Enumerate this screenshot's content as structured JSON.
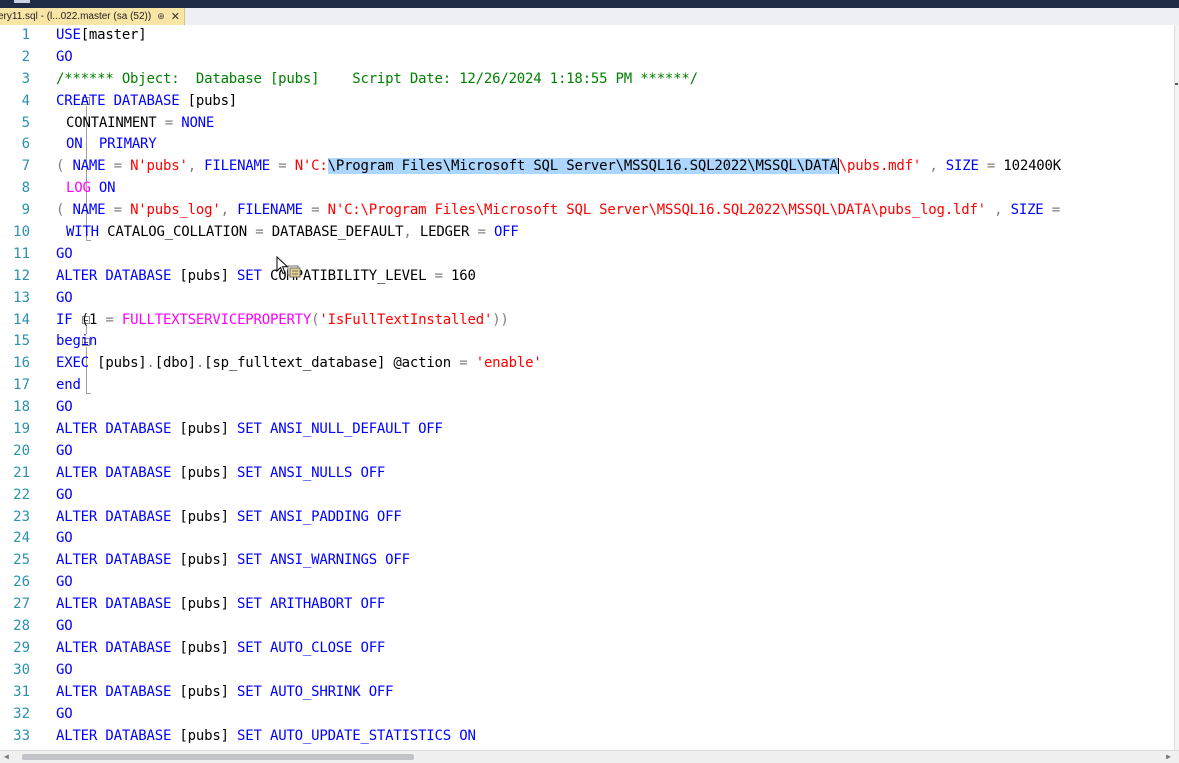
{
  "window": {
    "tab_title": "ery11.sql - (l...022.master (sa (52))",
    "tab_pin": "⊕",
    "tab_close": "✕"
  },
  "editor": {
    "lines": [
      {
        "n": "1",
        "segs": [
          [
            "kw",
            "USE"
          ],
          [
            "",
            "[master]"
          ]
        ]
      },
      {
        "n": "2",
        "segs": [
          [
            "kw",
            "GO"
          ]
        ]
      },
      {
        "n": "3",
        "segs": [
          [
            "cm",
            "/****** Object:  Database [pubs]    Script Date: 12/26/2024 1:18:55 PM ******/"
          ]
        ]
      },
      {
        "n": "4",
        "segs": [
          [
            "kw",
            "CREATE DATABASE"
          ],
          [
            "",
            " [pubs]"
          ]
        ]
      },
      {
        "n": "5",
        "indent": true,
        "segs": [
          [
            "",
            "CONTAINMENT "
          ],
          [
            "gr",
            "="
          ],
          [
            "kw",
            " NONE"
          ]
        ]
      },
      {
        "n": "6",
        "indent": true,
        "segs": [
          [
            "kw",
            "ON  PRIMARY"
          ]
        ]
      },
      {
        "n": "7",
        "segs": [
          [
            "gr",
            "( "
          ],
          [
            "kw",
            "NAME"
          ],
          [
            "gr",
            " = "
          ],
          [
            "st",
            "N'pubs'"
          ],
          [
            "gr",
            ", "
          ],
          [
            "kw",
            "FILENAME"
          ],
          [
            "gr",
            " = "
          ],
          [
            "st",
            "N'C:"
          ],
          [
            "sel",
            "\\Program Files\\Microsoft SQL Server\\MSSQL16.SQL2022\\MSSQL\\DATA"
          ],
          [
            "caret",
            ""
          ],
          [
            "st",
            "\\pubs.mdf'"
          ],
          [
            "gr",
            " , "
          ],
          [
            "kw",
            "SIZE"
          ],
          [
            "gr",
            " = "
          ],
          [
            "",
            "102400K"
          ]
        ]
      },
      {
        "n": "8",
        "indent": true,
        "segs": [
          [
            "fn",
            "LOG"
          ],
          [
            "kw",
            " ON"
          ]
        ]
      },
      {
        "n": "9",
        "segs": [
          [
            "gr",
            "( "
          ],
          [
            "kw",
            "NAME"
          ],
          [
            "gr",
            " = "
          ],
          [
            "st",
            "N'pubs_log'"
          ],
          [
            "gr",
            ", "
          ],
          [
            "kw",
            "FILENAME"
          ],
          [
            "gr",
            " = "
          ],
          [
            "st",
            "N'C:\\Program Files\\Microsoft SQL Server\\MSSQL16.SQL2022\\MSSQL\\DATA\\pubs_log.ldf'"
          ],
          [
            "gr",
            " , "
          ],
          [
            "kw",
            "SIZE"
          ],
          [
            "gr",
            " ="
          ]
        ]
      },
      {
        "n": "10",
        "indent": true,
        "segs": [
          [
            "kw",
            "WITH"
          ],
          [
            "",
            " CATALOG_COLLATION "
          ],
          [
            "gr",
            "="
          ],
          [
            "",
            " DATABASE_DEFAULT"
          ],
          [
            "gr",
            ", "
          ],
          [
            "",
            "LEDGER "
          ],
          [
            "gr",
            "="
          ],
          [
            "kw",
            " OFF"
          ]
        ]
      },
      {
        "n": "11",
        "segs": [
          [
            "kw",
            "GO"
          ]
        ]
      },
      {
        "n": "12",
        "segs": [
          [
            "kw",
            "ALTER DATABASE"
          ],
          [
            "",
            " [pubs] "
          ],
          [
            "kw",
            "SET "
          ],
          [
            "",
            "COMPATIBILITY_LEVEL "
          ],
          [
            "gr",
            "="
          ],
          [
            "",
            " 160"
          ]
        ]
      },
      {
        "n": "13",
        "segs": [
          [
            "kw",
            "GO"
          ]
        ]
      },
      {
        "n": "14",
        "segs": [
          [
            "kw",
            "IF"
          ],
          [
            "",
            " ("
          ],
          [
            "",
            "1 "
          ],
          [
            "gr",
            "="
          ],
          [
            "fn",
            " FULLTEXTSERVICEPROPERTY"
          ],
          [
            "gr",
            "("
          ],
          [
            "st",
            "'IsFullTextInstalled'"
          ],
          [
            "gr",
            "))"
          ]
        ]
      },
      {
        "n": "15",
        "segs": [
          [
            "kw",
            "begin"
          ]
        ]
      },
      {
        "n": "16",
        "segs": [
          [
            "kw",
            "EXEC"
          ],
          [
            "",
            " [pubs]"
          ],
          [
            "gr",
            "."
          ],
          [
            "",
            "[dbo]"
          ],
          [
            "gr",
            "."
          ],
          [
            "",
            "[sp_fulltext_database] @action "
          ],
          [
            "gr",
            "="
          ],
          [
            "st",
            " 'enable'"
          ]
        ]
      },
      {
        "n": "17",
        "segs": [
          [
            "kw",
            "end"
          ]
        ]
      },
      {
        "n": "18",
        "segs": [
          [
            "kw",
            "GO"
          ]
        ]
      },
      {
        "n": "19",
        "segs": [
          [
            "kw",
            "ALTER DATABASE"
          ],
          [
            "",
            " [pubs] "
          ],
          [
            "kw",
            "SET ANSI_NULL_DEFAULT OFF"
          ]
        ]
      },
      {
        "n": "20",
        "segs": [
          [
            "kw",
            "GO"
          ]
        ]
      },
      {
        "n": "21",
        "segs": [
          [
            "kw",
            "ALTER DATABASE"
          ],
          [
            "",
            " [pubs] "
          ],
          [
            "kw",
            "SET ANSI_NULLS OFF"
          ]
        ]
      },
      {
        "n": "22",
        "segs": [
          [
            "kw",
            "GO"
          ]
        ]
      },
      {
        "n": "23",
        "segs": [
          [
            "kw",
            "ALTER DATABASE"
          ],
          [
            "",
            " [pubs] "
          ],
          [
            "kw",
            "SET ANSI_PADDING OFF"
          ]
        ]
      },
      {
        "n": "24",
        "segs": [
          [
            "kw",
            "GO"
          ]
        ]
      },
      {
        "n": "25",
        "segs": [
          [
            "kw",
            "ALTER DATABASE"
          ],
          [
            "",
            " [pubs] "
          ],
          [
            "kw",
            "SET ANSI_WARNINGS OFF"
          ]
        ]
      },
      {
        "n": "26",
        "segs": [
          [
            "kw",
            "GO"
          ]
        ]
      },
      {
        "n": "27",
        "segs": [
          [
            "kw",
            "ALTER DATABASE"
          ],
          [
            "",
            " [pubs] "
          ],
          [
            "kw",
            "SET ARITHABORT OFF"
          ]
        ]
      },
      {
        "n": "28",
        "segs": [
          [
            "kw",
            "GO"
          ]
        ]
      },
      {
        "n": "29",
        "segs": [
          [
            "kw",
            "ALTER DATABASE"
          ],
          [
            "",
            " [pubs] "
          ],
          [
            "kw",
            "SET AUTO_CLOSE OFF"
          ]
        ]
      },
      {
        "n": "30",
        "segs": [
          [
            "kw",
            "GO"
          ]
        ]
      },
      {
        "n": "31",
        "segs": [
          [
            "kw",
            "ALTER DATABASE"
          ],
          [
            "",
            " [pubs] "
          ],
          [
            "kw",
            "SET AUTO_SHRINK OFF"
          ]
        ]
      },
      {
        "n": "32",
        "segs": [
          [
            "kw",
            "GO"
          ]
        ]
      },
      {
        "n": "33",
        "segs": [
          [
            "kw",
            "ALTER DATABASE"
          ],
          [
            "",
            " [pubs] "
          ],
          [
            "kw",
            "SET AUTO_UPDATE_STATISTICS ON"
          ]
        ]
      }
    ]
  },
  "colors": {
    "keyword": "#0000ff",
    "string": "#ff0000",
    "function": "#ff00ff",
    "comment": "#008000",
    "operator": "#808080",
    "line_number": "#2b91af",
    "selection": "#add6ff"
  },
  "icons": {
    "cursor": "mouse-pointer-icon",
    "tooltip": "quick-info-icon",
    "fold": "collapse-box-icon"
  }
}
